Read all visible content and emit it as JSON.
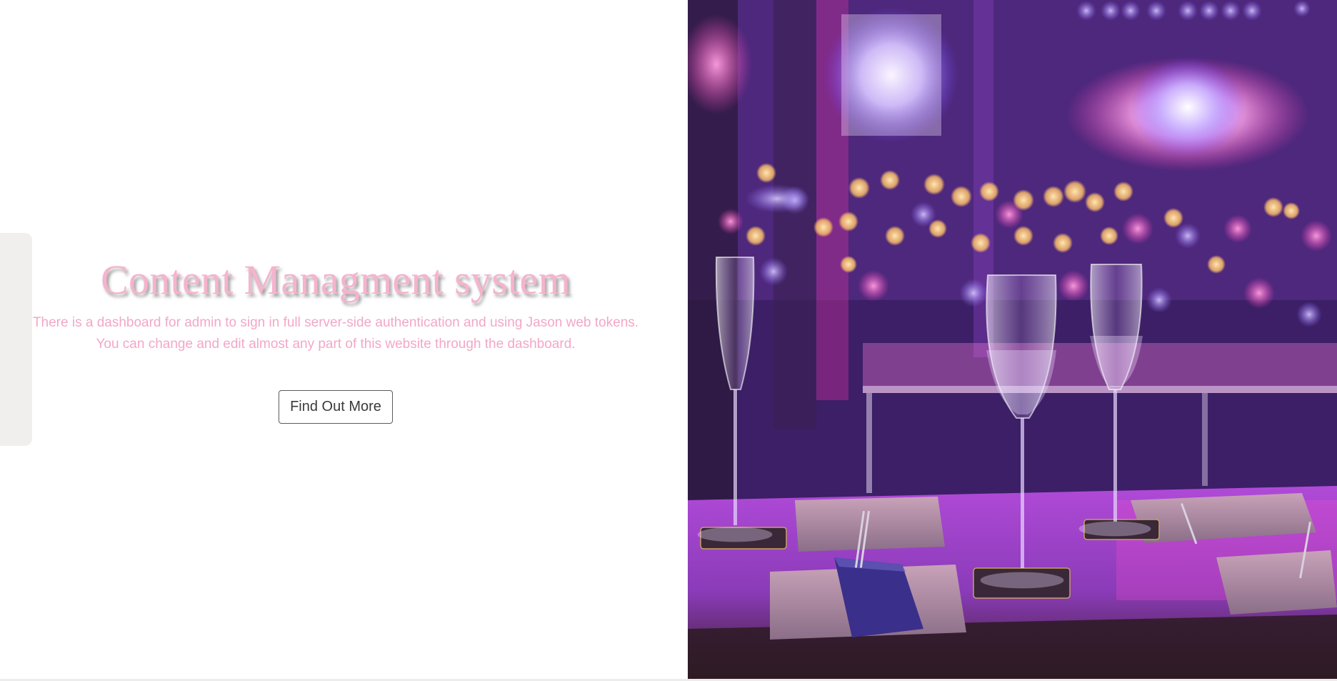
{
  "hero": {
    "title": "Content Managment system",
    "description_line1": "There is a dashboard for admin to sign in full server-side authentication and using Jason web tokens.",
    "description_line2": "You can change and edit almost any part of this website through the dashboard.",
    "cta_label": "Find Out More"
  },
  "image": {
    "subject": "wine glasses on a dinner table with purple and pink bokeh lights"
  },
  "colors": {
    "title": "#f6b3cd",
    "description": "#f3a7c6",
    "side_tab": "#f1efed",
    "button_border": "#5b5b5b"
  }
}
